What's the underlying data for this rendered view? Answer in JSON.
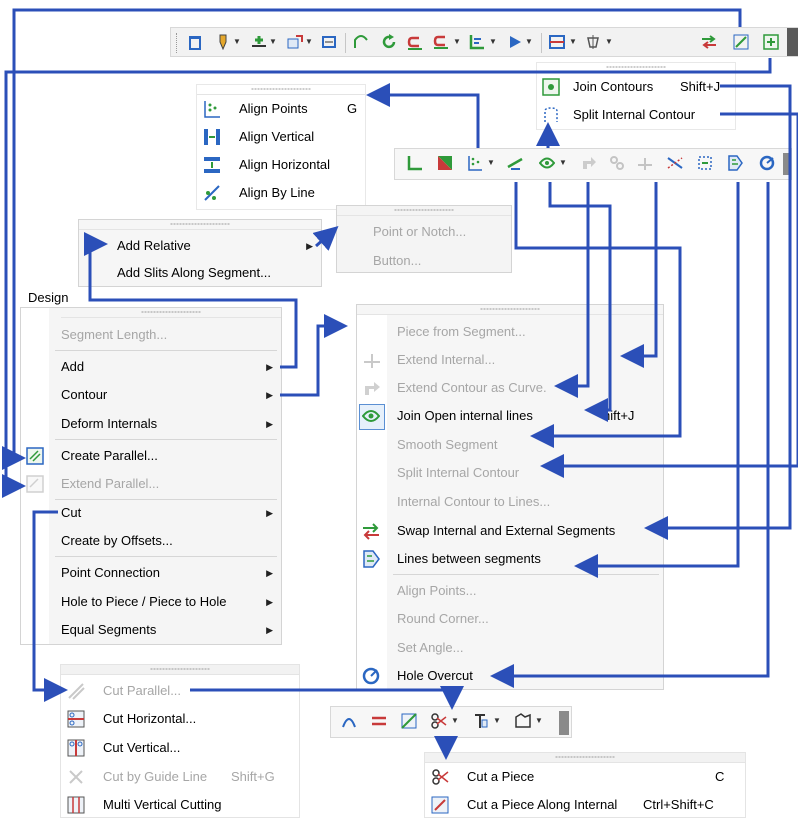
{
  "design_menu": {
    "title": "Design",
    "items": [
      {
        "label": "Segment Length...",
        "enabled": false
      },
      {
        "label": "Add",
        "submenu": true
      },
      {
        "label": "Contour",
        "submenu": true
      },
      {
        "label": "Deform Internals",
        "submenu": true
      },
      {
        "label": "Create Parallel..."
      },
      {
        "label": "Extend Parallel...",
        "enabled": false
      },
      {
        "label": "Cut",
        "submenu": true
      },
      {
        "label": "Create by Offsets..."
      },
      {
        "label": "Point Connection",
        "submenu": true
      },
      {
        "label": "Hole to Piece / Piece to Hole",
        "submenu": true
      },
      {
        "label": "Equal Segments",
        "submenu": true
      }
    ]
  },
  "add_menu": {
    "items": [
      {
        "label": "Add Relative",
        "submenu": true
      },
      {
        "label": "Add Slits Along Segment..."
      }
    ]
  },
  "relative_menu": {
    "items": [
      {
        "label": "Point or Notch...",
        "enabled": false
      },
      {
        "label": "Button...",
        "enabled": false
      }
    ]
  },
  "align_menu": {
    "items": [
      {
        "label": "Align Points",
        "shortcut": "G"
      },
      {
        "label": "Align Vertical"
      },
      {
        "label": "Align Horizontal"
      },
      {
        "label": "Align By Line"
      }
    ]
  },
  "join_menu": {
    "items": [
      {
        "label": "Join Contours",
        "shortcut": "Shift+J"
      },
      {
        "label": "Split Internal Contour"
      }
    ]
  },
  "contour_menu": {
    "items": [
      {
        "label": "Piece from Segment...",
        "enabled": false
      },
      {
        "label": "Extend Internal...",
        "enabled": false
      },
      {
        "label": "Extend Contour as Curve.",
        "enabled": false
      },
      {
        "label": "Join Open internal lines",
        "shortcut": "hift+J"
      },
      {
        "label": "Smooth Segment",
        "enabled": false
      },
      {
        "label": "Split Internal Contour",
        "enabled": false
      },
      {
        "label": "Internal Contour to Lines...",
        "enabled": false
      },
      {
        "label": "Swap Internal and External Segments"
      },
      {
        "label": "Lines between segments"
      },
      {
        "label": "Align Points...",
        "enabled": false
      },
      {
        "label": "Round Corner...",
        "enabled": false
      },
      {
        "label": "Set Angle...",
        "enabled": false
      },
      {
        "label": "Hole Overcut"
      }
    ]
  },
  "cut_menu": {
    "items": [
      {
        "label": "Cut Parallel...",
        "enabled": false
      },
      {
        "label": "Cut Horizontal..."
      },
      {
        "label": "Cut Vertical..."
      },
      {
        "label": "Cut by Guide Line",
        "shortcut": "Shift+G",
        "enabled": false
      },
      {
        "label": "Multi Vertical Cutting"
      }
    ]
  },
  "piece_menu": {
    "items": [
      {
        "label": "Cut a Piece",
        "shortcut": "C"
      },
      {
        "label": "Cut a Piece Along Internal",
        "shortcut": "Ctrl+Shift+C"
      }
    ]
  },
  "colors": {
    "arrow": "#2b4fb8",
    "menu_bg": "#f4f4f4",
    "disabled": "#a6a6a6",
    "icon_green": "#2f9a3a",
    "icon_blue": "#2b67c2",
    "icon_red": "#c83a3a"
  }
}
